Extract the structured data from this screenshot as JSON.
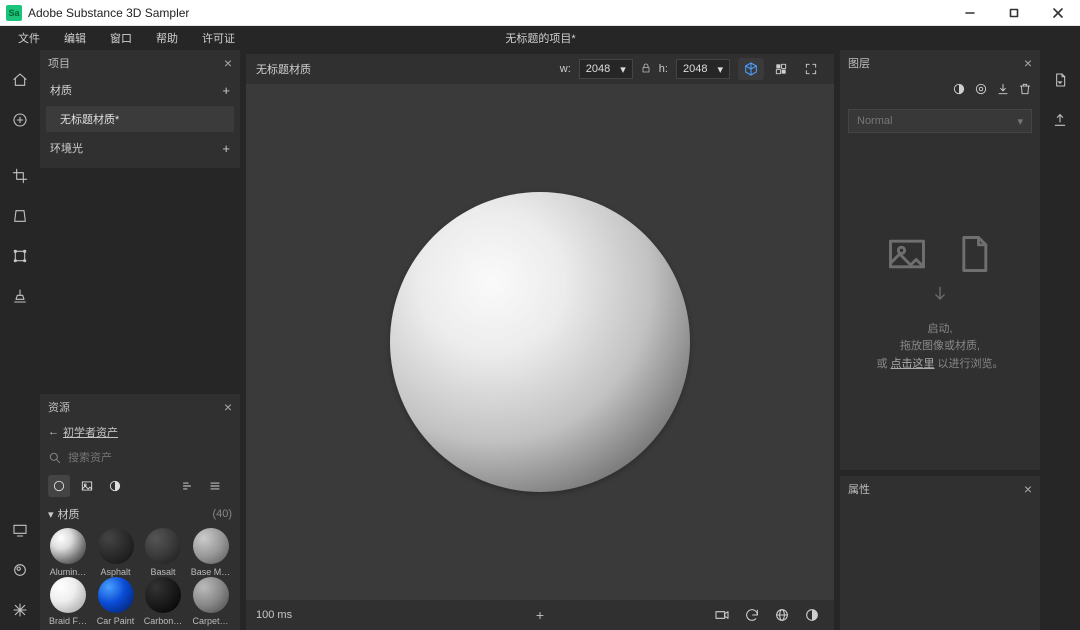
{
  "titlebar": {
    "app_name": "Adobe Substance 3D Sampler",
    "icon_letters": "Sa"
  },
  "menubar": {
    "items": [
      "文件",
      "编辑",
      "窗口",
      "帮助",
      "许可证"
    ],
    "project_title": "无标题的项目*"
  },
  "project_panel": {
    "title": "项目",
    "sections": {
      "materials": "材质",
      "env_light": "环境光"
    },
    "untitled_material": "无标题材质*"
  },
  "assets_panel": {
    "title": "资源",
    "back_link": "初学者资产",
    "search_placeholder": "搜索资产",
    "category": "材质",
    "count": "(40)",
    "thumbs": [
      "Alumin…",
      "Asphalt",
      "Basalt",
      "Base M…",
      "Braid F…",
      "Car Paint",
      "Carbon…",
      "Carpet…"
    ]
  },
  "viewport": {
    "title": "无标题材质",
    "w_label": "w:",
    "w_value": "2048",
    "h_label": "h:",
    "h_value": "2048",
    "status_time": "100 ms"
  },
  "layers_panel": {
    "title": "图层",
    "blend_mode": "Normal",
    "drop": {
      "line1": "启动,",
      "line2": "拖放图像或材质,",
      "line3_pre": "或 ",
      "line3_link": "点击这里",
      "line3_post": " 以进行浏览。"
    }
  },
  "props_panel": {
    "title": "属性"
  }
}
